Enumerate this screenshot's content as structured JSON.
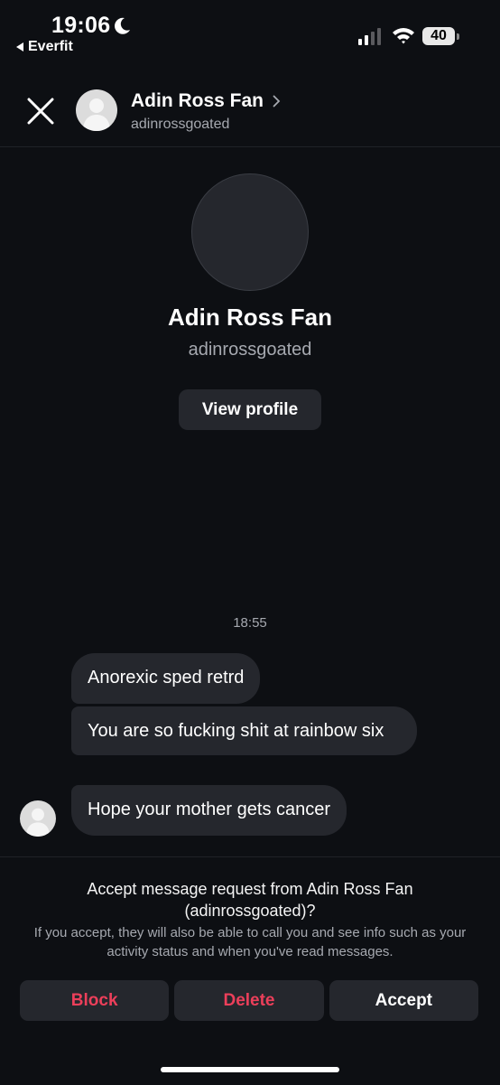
{
  "status_bar": {
    "time": "19:06",
    "back_app": "Everfit",
    "battery": "40"
  },
  "header": {
    "name": "Adin Ross Fan",
    "handle": "adinrossgoated"
  },
  "profile": {
    "name": "Adin Ross Fan",
    "handle": "adinrossgoated",
    "view_profile_label": "View profile"
  },
  "conversation": {
    "timestamp": "18:55",
    "messages": [
      {
        "text": "Anorexic sped retrd"
      },
      {
        "text": "You are so fucking shit at rainbow six"
      },
      {
        "text": "Hope your mother gets cancer"
      }
    ]
  },
  "request": {
    "title": "Accept message request from Adin Ross Fan (adinrossgoated)?",
    "info": "If you accept, they will also be able to call you and see info such as your activity status and when you've read messages.",
    "block_label": "Block",
    "delete_label": "Delete",
    "accept_label": "Accept"
  },
  "colors": {
    "background": "#0d0f13",
    "bubble": "#25272d",
    "danger": "#ec3f5a",
    "secondary_text": "#a6a9b0"
  }
}
